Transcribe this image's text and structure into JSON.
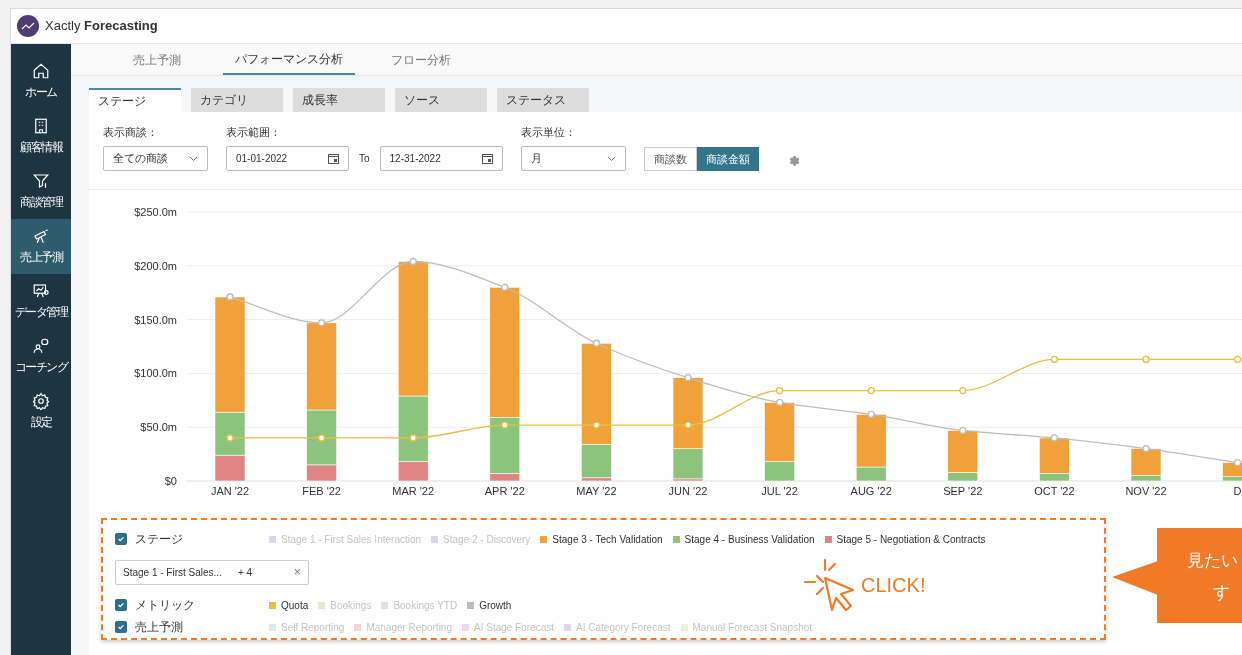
{
  "header": {
    "brand_light": "Xactly",
    "brand_bold": "Forecasting"
  },
  "sidebar": {
    "items": [
      {
        "label": "ホーム",
        "selected": false
      },
      {
        "label": "顧客情報",
        "selected": false
      },
      {
        "label": "商談管理",
        "selected": false
      },
      {
        "label": "売上予測",
        "selected": true
      },
      {
        "label": "データ管理",
        "selected": false
      },
      {
        "label": "コーチング",
        "selected": false
      },
      {
        "label": "設定",
        "selected": false
      }
    ]
  },
  "tabs": [
    {
      "label": "売上予測",
      "selected": false
    },
    {
      "label": "パフォーマンス分析",
      "selected": true
    },
    {
      "label": "フロー分析",
      "selected": false
    }
  ],
  "sub_tabs": [
    {
      "label": "ステージ",
      "selected": true
    },
    {
      "label": "カテゴリ",
      "selected": false
    },
    {
      "label": "成長率",
      "selected": false
    },
    {
      "label": "ソース",
      "selected": false
    },
    {
      "label": "ステータス",
      "selected": false
    }
  ],
  "filters": {
    "deal_label": "表示商談：",
    "deal_value": "全ての商談",
    "range_label": "表示範囲：",
    "range_from": "01-01-2022",
    "range_to_label": "To",
    "range_to": "12-31-2022",
    "unit_label": "表示単位：",
    "unit_value": "月",
    "toggle": [
      {
        "label": "商談数",
        "selected": false
      },
      {
        "label": "商談金額",
        "selected": true
      }
    ]
  },
  "chart": {
    "chart_data": {
      "type": "bar",
      "stacked": true,
      "grid": true,
      "categories": [
        "JAN '22",
        "FEB '22",
        "MAR '22",
        "APR '22",
        "MAY '22",
        "JUN '22",
        "JUL '22",
        "AUG '22",
        "SEP '22",
        "OCT '22",
        "NOV '22",
        "D"
      ],
      "ylim": [
        0,
        250
      ],
      "yticks": [
        {
          "value": 0,
          "label": "$0"
        },
        {
          "value": 50,
          "label": "$50.0m"
        },
        {
          "value": 100,
          "label": "$100.0m"
        },
        {
          "value": 150,
          "label": "$150.0m"
        },
        {
          "value": 200,
          "label": "$200.0m"
        },
        {
          "value": 250,
          "label": "$250.0m"
        }
      ],
      "series": [
        {
          "name": "Stage 3 - Tech Validation",
          "color": "#f0a13a",
          "type": "bar",
          "values": [
            107,
            81,
            125,
            121,
            94,
            66,
            55,
            49,
            39,
            33,
            25,
            13
          ]
        },
        {
          "name": "Stage 4 - Business Validation",
          "color": "#8cc47e",
          "type": "bar",
          "values": [
            40,
            51,
            61,
            52,
            31,
            28,
            18,
            13,
            8,
            7,
            5,
            4
          ]
        },
        {
          "name": "Stage 5 - Negotiation & Contracts",
          "color": "#e08585",
          "type": "bar",
          "values": [
            24,
            15,
            18,
            7,
            3,
            2,
            0,
            0,
            0,
            0,
            0,
            0
          ]
        },
        {
          "name": "Quota",
          "color": "#e8c040",
          "type": "line",
          "marker": true,
          "values": [
            40,
            40,
            40,
            52,
            52,
            52,
            84,
            84,
            84,
            113,
            113,
            113
          ]
        },
        {
          "name": "Growth",
          "color": "#bdbdbd",
          "type": "line",
          "marker": true,
          "values": [
            171,
            147,
            204,
            180,
            128,
            96,
            73,
            62,
            47,
            40,
            30,
            17
          ]
        }
      ]
    }
  },
  "legend": {
    "groups": [
      {
        "label": "ステージ",
        "checked": true,
        "items": [
          {
            "kind": "label",
            "label": "Stage 1 - First Sales Interaction",
            "color": "#dcd6ec",
            "active": false
          },
          {
            "kind": "label",
            "label": "Stage 2 - Discovery",
            "color": "#d2deed",
            "active": false
          },
          {
            "kind": "series",
            "active": true
          },
          {
            "kind": "series",
            "active": true
          },
          {
            "kind": "series",
            "active": true
          }
        ],
        "chip": {
          "value": "Stage 1 - First Sales...",
          "count": "+ 4",
          "clear": "×"
        }
      },
      {
        "label": "メトリック",
        "checked": true,
        "items": [
          {
            "kind": "series",
            "active": true
          },
          {
            "kind": "label",
            "label": "Bookings",
            "color": "#e2ebcf",
            "active": false
          },
          {
            "kind": "label",
            "label": "Bookings YTD",
            "color": "#eed8ee",
            "active": false
          },
          {
            "kind": "series",
            "active": true
          }
        ]
      },
      {
        "label": "売上予測",
        "checked": true,
        "items": [
          {
            "kind": "label",
            "label": "Self Reporting",
            "color": "#d6edf1",
            "active": false
          },
          {
            "kind": "label",
            "label": "Manager Reporting",
            "color": "#f5d6d6",
            "active": false
          },
          {
            "kind": "label",
            "label": "AI Stage Forecast",
            "color": "#f1d6f1",
            "active": false
          },
          {
            "kind": "label",
            "label": "AI Category Forecast",
            "color": "#ddd6ee",
            "active": false
          },
          {
            "kind": "label",
            "label": "Manual Forecast Snapshot",
            "color": "#eff1d3",
            "active": false
          }
        ]
      }
    ],
    "click_hint": "CLICK!"
  },
  "callout": {
    "lines": [
      "見たい",
      "す"
    ]
  }
}
